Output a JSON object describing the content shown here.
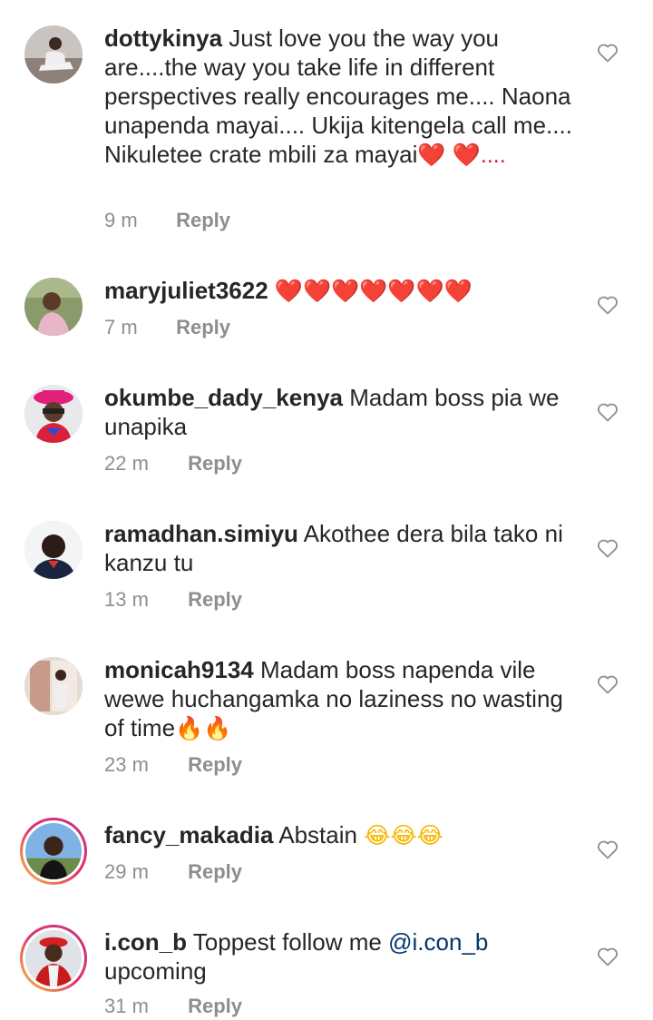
{
  "comments": [
    {
      "username": "dottykinya",
      "text": "Just love you the way you are....the way you take life in different perspectives really encourages me.... Naona unapenda mayai.... Ukija kitengela call me.... Nikuletee crate mbili za mayai",
      "emoji_tail": "❤️",
      "text_tail": "❤️....",
      "time": "9 m",
      "reply_label": "Reply"
    },
    {
      "username": "maryjuliet3622",
      "emoji": "❤️❤️❤️❤️❤️❤️❤️",
      "time": "7 m",
      "reply_label": "Reply"
    },
    {
      "username": "okumbe_dady_kenya",
      "text": "Madam boss pia we unapika",
      "time": "22 m",
      "reply_label": "Reply"
    },
    {
      "username": "ramadhan.simiyu",
      "text": "Akothee dera bila tako ni kanzu tu",
      "time": "13 m",
      "reply_label": "Reply"
    },
    {
      "username": "monicah9134",
      "text": "Madam boss  napenda vile wewe huchangamka no laziness no wasting of time",
      "emoji": "🔥🔥",
      "time": "23 m",
      "reply_label": "Reply"
    },
    {
      "username": "fancy_makadia",
      "text": "Abstain",
      "emoji": "😂😂😂",
      "time": "29 m",
      "reply_label": "Reply"
    },
    {
      "username": "i.con_b",
      "text": "Toppest follow me",
      "mention": "@i.con_b",
      "text_after": "upcoming",
      "time": "31 m",
      "reply_label": "Reply"
    }
  ],
  "icons": {
    "like": "heart-outline-icon"
  },
  "colors": {
    "text": "#262626",
    "meta": "#8e8e8e",
    "mention": "#00376b",
    "story_ring": "#e1306c"
  }
}
